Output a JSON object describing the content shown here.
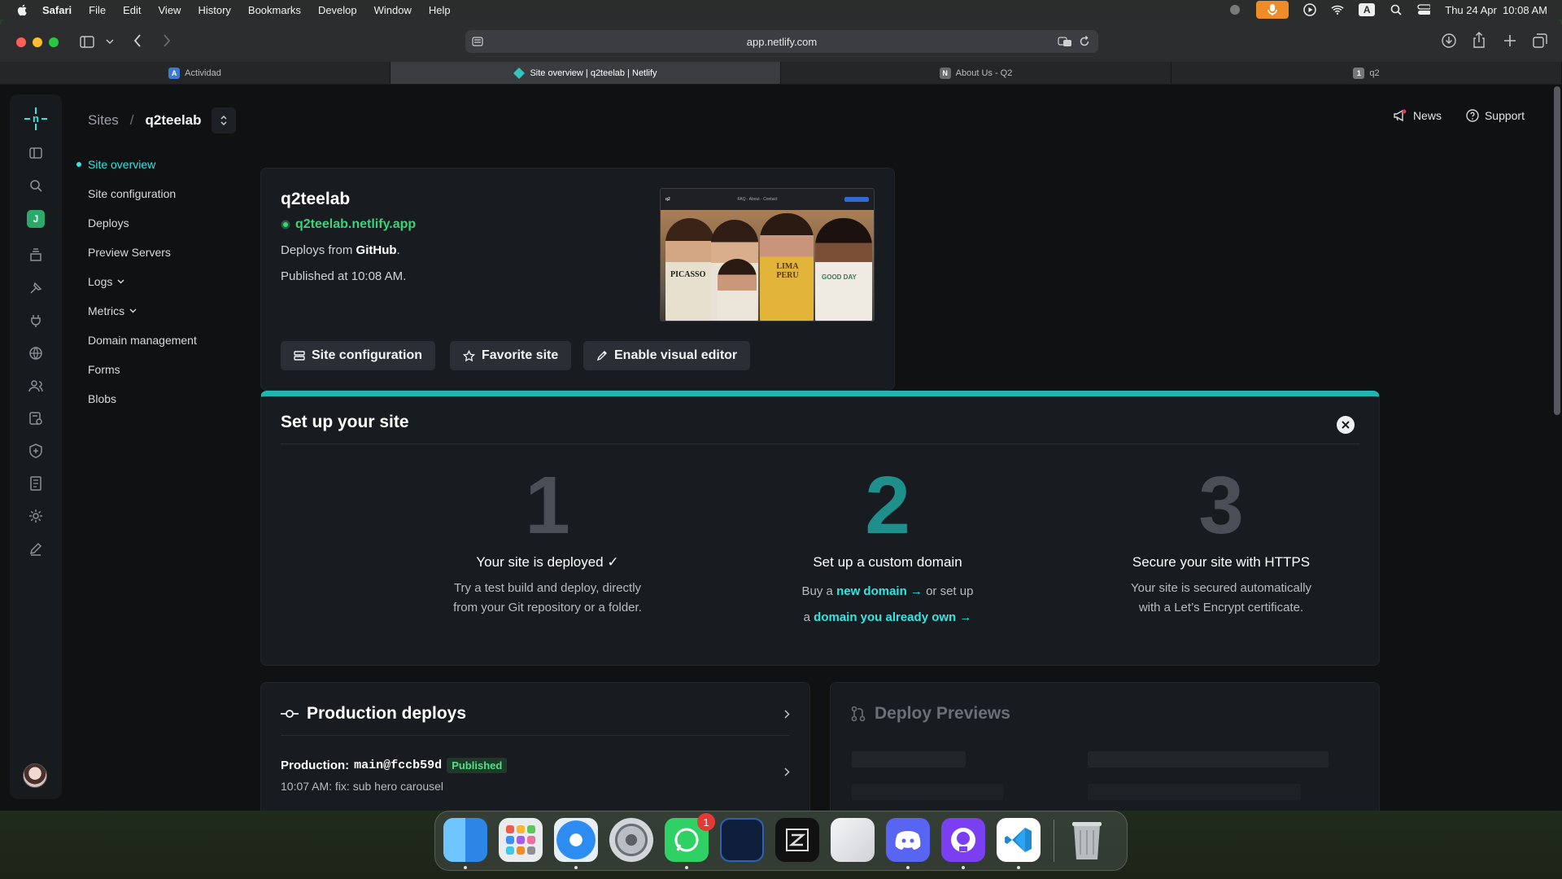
{
  "menubar": {
    "items": [
      "Safari",
      "File",
      "Edit",
      "View",
      "History",
      "Bookmarks",
      "Develop",
      "Window",
      "Help"
    ],
    "datetime": "Thu 24 Apr  10:08 AM",
    "input_indicator": "A"
  },
  "browser": {
    "url": "app.netlify.com",
    "tabs": [
      {
        "title": "Actividad",
        "favicon": "A"
      },
      {
        "title": "Site overview | q2teelab | Netlify",
        "favicon": ""
      },
      {
        "title": "About Us - Q2",
        "favicon": "N"
      },
      {
        "title": "q2",
        "favicon": "1"
      }
    ]
  },
  "header": {
    "breadcrumb_root": "Sites",
    "breadcrumb_sep": "/",
    "site_name": "q2teelab",
    "news_label": "News",
    "support_label": "Support"
  },
  "rail": {
    "team_initial": "J"
  },
  "nav": {
    "items": [
      "Site overview",
      "Site configuration",
      "Deploys",
      "Preview Servers",
      "Logs",
      "Metrics",
      "Domain management",
      "Forms",
      "Blobs"
    ]
  },
  "site": {
    "name": "q2teelab",
    "url": "q2teelab.netlify.app",
    "deploys_from_prefix": "Deploys from ",
    "deploys_from_source": "GitHub",
    "deploys_from_suffix": ".",
    "published": "Published at 10:08 AM.",
    "buttons": {
      "config": "Site configuration",
      "favorite": "Favorite site",
      "visual_editor": "Enable visual editor"
    },
    "thumbnail": {
      "nav_logo": "q2",
      "nav_links": "FAQ · About · Contact",
      "shirt_texts": [
        "PICASSO",
        "LIMA PERU",
        "GOOD DAY"
      ]
    }
  },
  "setup": {
    "title": "Set up your site",
    "steps": [
      {
        "number": "1",
        "title": "Your site is deployed ✓",
        "desc_line1": "Try a test build and deploy, directly",
        "desc_line2": "from your Git repository or a folder."
      },
      {
        "number": "2",
        "title": "Set up a custom domain",
        "pre1": "Buy a ",
        "link1": "new domain →",
        "mid": " or set up",
        "pre2": "a ",
        "link2": "domain you already own →"
      },
      {
        "number": "3",
        "title": "Secure your site with HTTPS",
        "desc_line1": "Your site is secured automatically",
        "desc_line2": "with a Let’s Encrypt certificate."
      }
    ]
  },
  "production": {
    "title": "Production deploys",
    "deploy_label": "Production:",
    "deploy_ref": "main@fccb59d",
    "badge": "Published",
    "message": "10:07 AM: fix: sub hero carousel"
  },
  "previews": {
    "title": "Deploy Previews"
  },
  "dock": {
    "whatsapp_badge": "1"
  },
  "colors": {
    "accent": "#32e6e2",
    "success": "#3ad27a",
    "background": "#0f1113",
    "card": "#181b1f"
  }
}
